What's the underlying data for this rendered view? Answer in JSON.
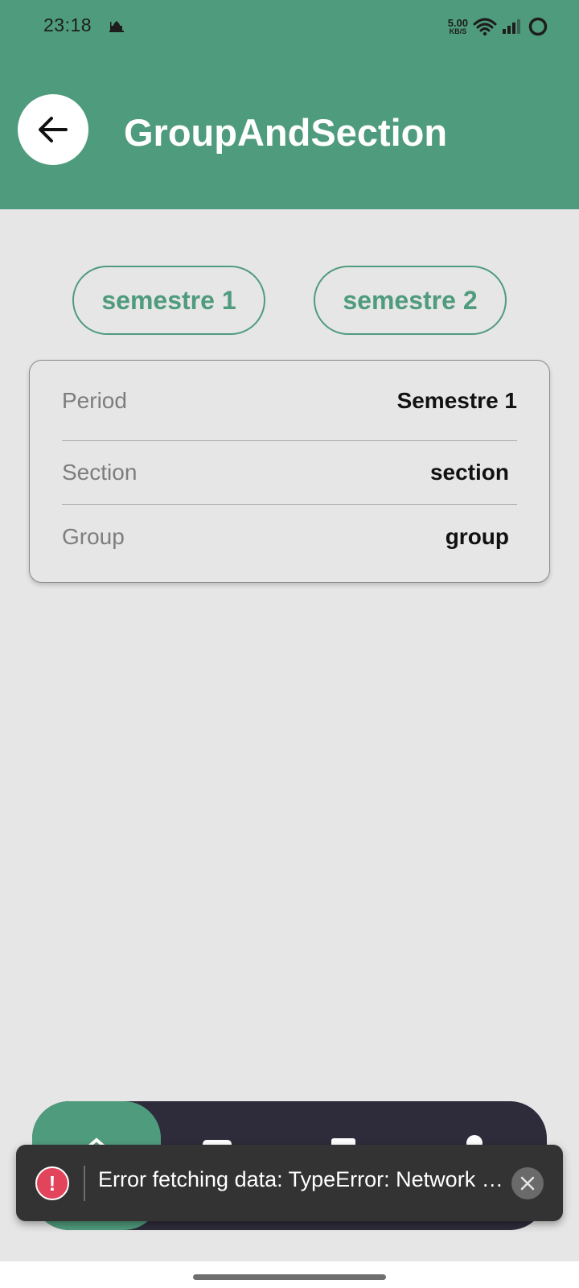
{
  "status_bar": {
    "time": "23:18",
    "net_speed_value": "5.00",
    "net_speed_unit": "KB/S"
  },
  "header": {
    "title": "GroupAndSection",
    "color": "#4f9b7d"
  },
  "semesters": [
    {
      "label": "semestre 1"
    },
    {
      "label": "semestre 2"
    }
  ],
  "info": {
    "rows": [
      {
        "label": "Period",
        "value": "Semestre 1"
      },
      {
        "label": "Section",
        "value": "section"
      },
      {
        "label": "Group",
        "value": "group"
      }
    ]
  },
  "bottom_nav": {
    "items": [
      {
        "icon": "home-icon",
        "active": true
      },
      {
        "icon": "mail-icon",
        "active": false
      },
      {
        "icon": "calendar-icon",
        "active": false
      },
      {
        "icon": "person-icon",
        "active": false
      }
    ]
  },
  "toast": {
    "icon_glyph": "!",
    "message": "Error fetching data:  TypeError: Network request failed",
    "close_glyph": "×"
  }
}
